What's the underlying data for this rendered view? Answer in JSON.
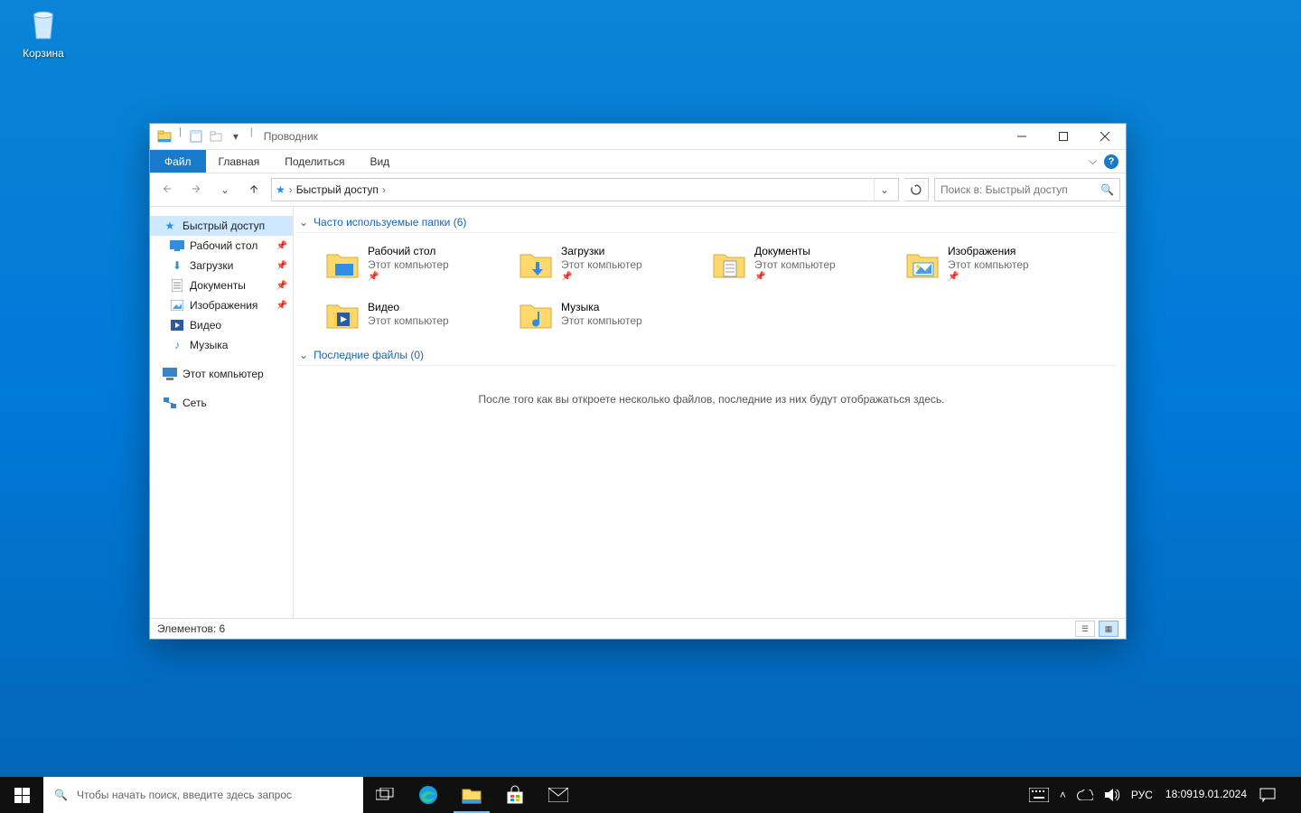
{
  "desktop": {
    "recycle_bin": "Корзина"
  },
  "window": {
    "title": "Проводник",
    "tabs": {
      "file": "Файл",
      "home": "Главная",
      "share": "Поделиться",
      "view": "Вид"
    }
  },
  "breadcrumb": {
    "location": "Быстрый доступ"
  },
  "search": {
    "placeholder": "Поиск в: Быстрый доступ"
  },
  "navpane": {
    "quick_access": "Быстрый доступ",
    "desktop": "Рабочий стол",
    "downloads": "Загрузки",
    "documents": "Документы",
    "pictures": "Изображения",
    "videos": "Видео",
    "music": "Музыка",
    "this_pc": "Этот компьютер",
    "network": "Сеть"
  },
  "content": {
    "group_frequent": "Часто используемые папки (6)",
    "group_recent": "Последние файлы (0)",
    "this_pc": "Этот компьютер",
    "empty_recent": "После того как вы откроете несколько файлов, последние из них будут отображаться здесь.",
    "folders": {
      "desktop": "Рабочий стол",
      "downloads": "Загрузки",
      "documents": "Документы",
      "pictures": "Изображения",
      "videos": "Видео",
      "music": "Музыка"
    }
  },
  "statusbar": {
    "items": "Элементов: 6"
  },
  "taskbar": {
    "search_placeholder": "Чтобы начать поиск, введите здесь запрос",
    "lang": "РУС",
    "time": "18:09",
    "date": "19.01.2024"
  }
}
